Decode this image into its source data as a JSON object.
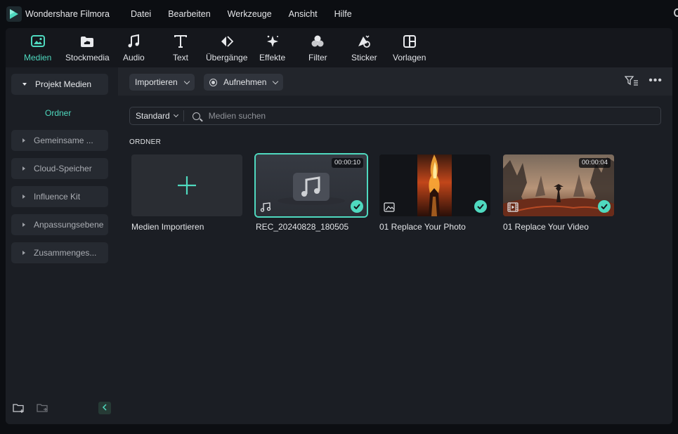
{
  "app": {
    "name": "Wondershare Filmora",
    "accent": "#4fd9bf"
  },
  "menu": [
    "Datei",
    "Bearbeiten",
    "Werkzeuge",
    "Ansicht",
    "Hilfe"
  ],
  "toolbar": {
    "items": [
      {
        "label": "Medien",
        "icon": "media-icon",
        "active": true
      },
      {
        "label": "Stockmedia",
        "icon": "cloud-folder-icon"
      },
      {
        "label": "Audio",
        "icon": "music-note-icon"
      },
      {
        "label": "Text",
        "icon": "text-icon"
      },
      {
        "label": "Übergänge",
        "icon": "transition-icon"
      },
      {
        "label": "Effekte",
        "icon": "sparkle-icon"
      },
      {
        "label": "Filter",
        "icon": "filter-icon"
      },
      {
        "label": "Sticker",
        "icon": "sticker-icon"
      },
      {
        "label": "Vorlagen",
        "icon": "template-icon"
      }
    ]
  },
  "sidebar": {
    "items": [
      {
        "label": "Projekt Medien",
        "expanded": true
      },
      {
        "label": "Gemeinsame ..."
      },
      {
        "label": "Cloud-Speicher"
      },
      {
        "label": "Influence Kit"
      },
      {
        "label": "Anpassungsebene"
      },
      {
        "label": "Zusammenges..."
      }
    ],
    "sub_item": "Ordner"
  },
  "content": {
    "import_button": "Importieren",
    "record_button": "Aufnehmen",
    "sort_label": "Standard",
    "search_placeholder": "Medien suchen",
    "section_label": "ORDNER",
    "cards": [
      {
        "title": "Medien Importieren",
        "type": "import"
      },
      {
        "title": "REC_20240828_180505",
        "type": "audio",
        "duration": "00:00:10",
        "selected": true
      },
      {
        "title": "01 Replace Your Photo",
        "type": "image"
      },
      {
        "title": "01 Replace Your Video",
        "type": "video",
        "duration": "00:00:04"
      }
    ]
  }
}
